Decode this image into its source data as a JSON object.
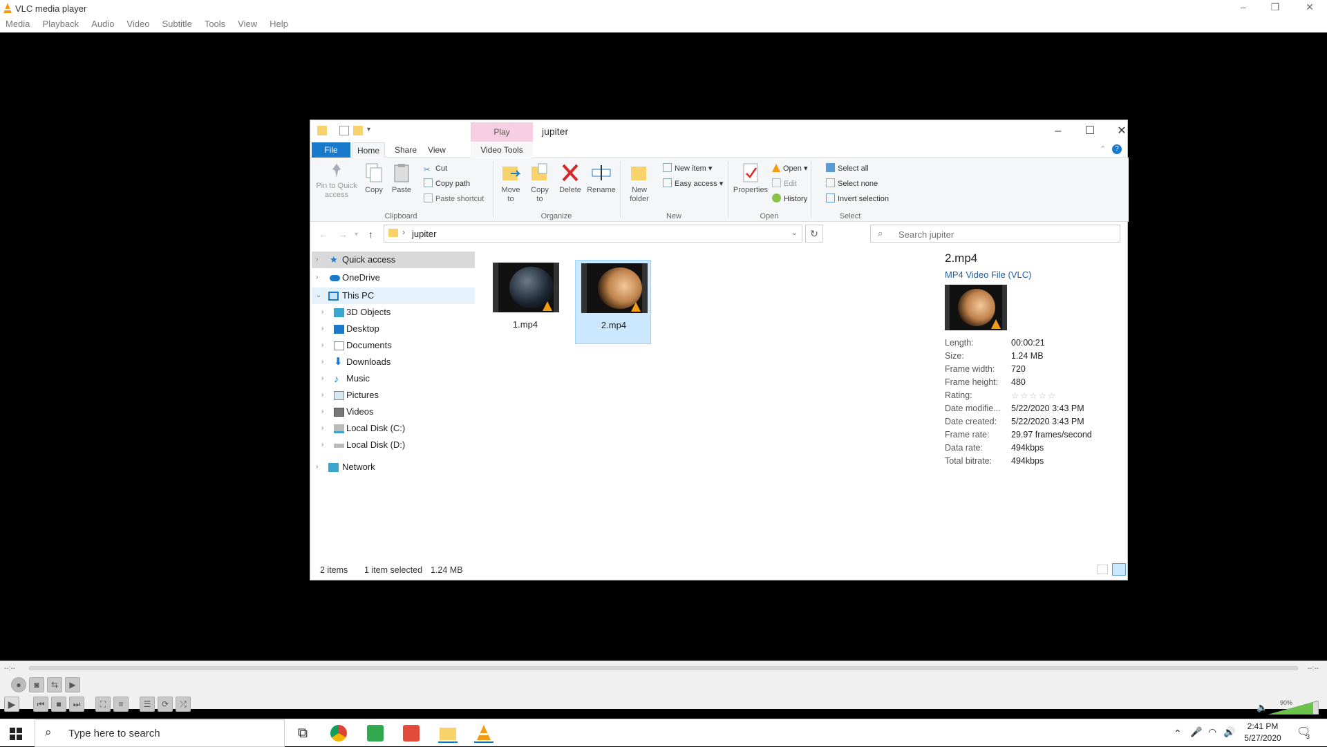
{
  "vlc": {
    "title": "VLC media player",
    "menu": [
      "Media",
      "Playback",
      "Audio",
      "Video",
      "Subtitle",
      "Tools",
      "View",
      "Help"
    ],
    "elapsed": "--:--",
    "remaining": "--:--",
    "volume": "90%"
  },
  "explorer": {
    "title": "jupiter",
    "contextual_tab": "Play",
    "tabs": {
      "file": "File",
      "home": "Home",
      "share": "Share",
      "view": "View",
      "video_tools": "Video Tools"
    },
    "ribbon": {
      "pin": "Pin to Quick access",
      "copy": "Copy",
      "paste": "Paste",
      "cut": "Cut",
      "copy_path": "Copy path",
      "paste_shortcut": "Paste shortcut",
      "move_to": "Move to",
      "copy_to": "Copy to",
      "delete": "Delete",
      "rename": "Rename",
      "new_folder": "New folder",
      "new_item": "New item",
      "easy_access": "Easy access",
      "properties": "Properties",
      "open": "Open",
      "edit": "Edit",
      "history": "History",
      "select_all": "Select all",
      "select_none": "Select none",
      "invert_selection": "Invert selection",
      "groups": {
        "clipboard": "Clipboard",
        "organize": "Organize",
        "new": "New",
        "open": "Open",
        "select": "Select"
      }
    },
    "address": {
      "path": "jupiter"
    },
    "search": {
      "placeholder": "Search jupiter"
    },
    "nav": [
      {
        "label": "Quick access"
      },
      {
        "label": "OneDrive"
      },
      {
        "label": "This PC"
      },
      {
        "label": "3D Objects"
      },
      {
        "label": "Desktop"
      },
      {
        "label": "Documents"
      },
      {
        "label": "Downloads"
      },
      {
        "label": "Music"
      },
      {
        "label": "Pictures"
      },
      {
        "label": "Videos"
      },
      {
        "label": "Local Disk (C:)"
      },
      {
        "label": "Local Disk (D:)"
      },
      {
        "label": "Network"
      }
    ],
    "files": [
      {
        "name": "1.mp4",
        "selected": false
      },
      {
        "name": "2.mp4",
        "selected": true
      }
    ],
    "details": {
      "name": "2.mp4",
      "type": "MP4 Video File (VLC)",
      "rows": [
        {
          "k": "Length:",
          "v": "00:00:21"
        },
        {
          "k": "Size:",
          "v": "1.24 MB"
        },
        {
          "k": "Frame width:",
          "v": "720"
        },
        {
          "k": "Frame height:",
          "v": "480"
        },
        {
          "k": "Rating:",
          "v": "☆☆☆☆☆"
        },
        {
          "k": "Date modifie...",
          "v": "5/22/2020 3:43 PM"
        },
        {
          "k": "Date created:",
          "v": "5/22/2020 3:43 PM"
        },
        {
          "k": "Frame rate:",
          "v": "29.97 frames/second"
        },
        {
          "k": "Data rate:",
          "v": "494kbps"
        },
        {
          "k": "Total bitrate:",
          "v": "494kbps"
        }
      ]
    },
    "status": {
      "items": "2 items",
      "selected": "1 item selected",
      "size": "1.24 MB"
    }
  },
  "taskbar": {
    "search_placeholder": "Type here to search",
    "time": "2:41 PM",
    "date": "5/27/2020",
    "notifications": "3"
  }
}
